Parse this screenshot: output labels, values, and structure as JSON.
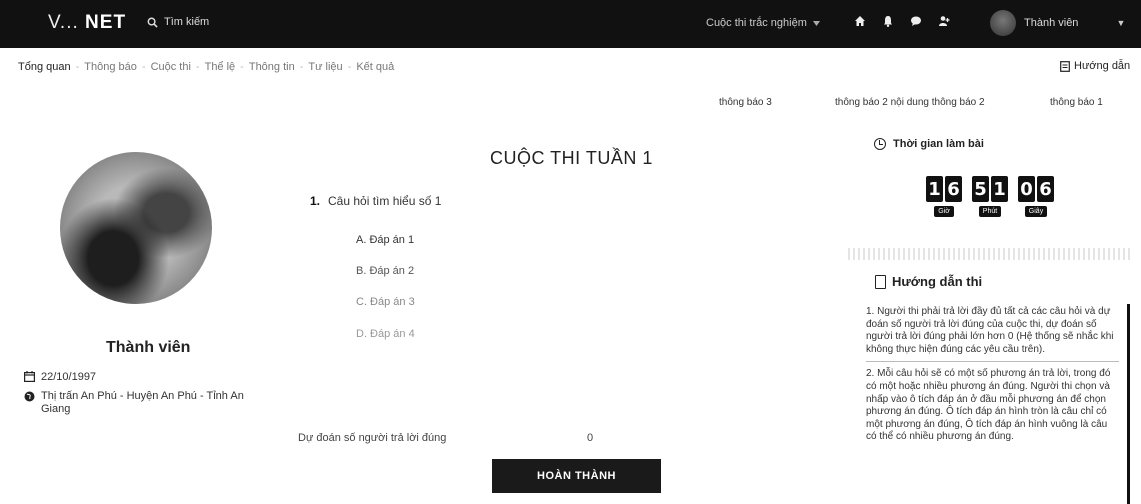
{
  "topbar": {
    "logo_prefix": "V...",
    "logo_main": "NET",
    "search_label": "Tìm kiếm",
    "contest_menu": "Cuộc thi trắc nghiệm",
    "user_label": "Thành viên"
  },
  "subnav": {
    "items": [
      "Tổng quan",
      "Thông báo",
      "Cuộc thi",
      "Thể lệ",
      "Thông tin",
      "Tư liệu",
      "Kết quả"
    ],
    "guide_link": "Hướng dẫn"
  },
  "notices": [
    "thông báo 3",
    "thông báo 2 nội dung thông báo 2",
    "thông báo 1"
  ],
  "profile": {
    "name": "Thành viên",
    "birthday": "22/10/1997",
    "address": "Thị trấn An Phú - Huyện An Phú - Tỉnh An Giang"
  },
  "quiz": {
    "title": "CUỘC THI TUẦN 1",
    "question_number": "1.",
    "question_text": "Câu hỏi tìm hiểu số 1",
    "answers": [
      "A. Đáp án 1",
      "B. Đáp án 2",
      "C. Đáp án 3",
      "D. Đáp án 4"
    ],
    "predict_label": "Dự đoán số người trả lời đúng",
    "predict_value": "0",
    "finish_button": "HOÀN THÀNH"
  },
  "timer": {
    "title": "Thời gian làm bài",
    "hours": [
      "1",
      "6"
    ],
    "minutes": [
      "5",
      "1"
    ],
    "seconds": [
      "0",
      "6"
    ],
    "unit_hours": "Giờ",
    "unit_minutes": "Phút",
    "unit_seconds": "Giây"
  },
  "guide": {
    "title": "Hướng dẫn thi",
    "paragraphs": [
      "1. Người thi phải trả lời đầy đủ tất cả các câu hỏi và dự đoán số người trả lời đúng của cuộc thi, dự đoán số người trả lời đúng phải lớn hơn 0 (Hệ thống sẽ nhắc khi không thực hiện đúng các yêu cầu trên).",
      "2. Mỗi câu hỏi sẽ có một số phương án trả lời, trong đó có một hoặc nhiều phương án đúng. Người thi chọn và nhấp vào ô tích đáp án ở đầu mỗi phương án để chọn phương án đúng. Ô tích đáp án hình tròn là câu chỉ có một phương án đúng, Ô tích đáp án hình vuông là câu có thể có nhiều phương án đúng."
    ]
  },
  "colors": {
    "topbar_bg": "#111111",
    "button_bg": "#1a1a1a"
  }
}
